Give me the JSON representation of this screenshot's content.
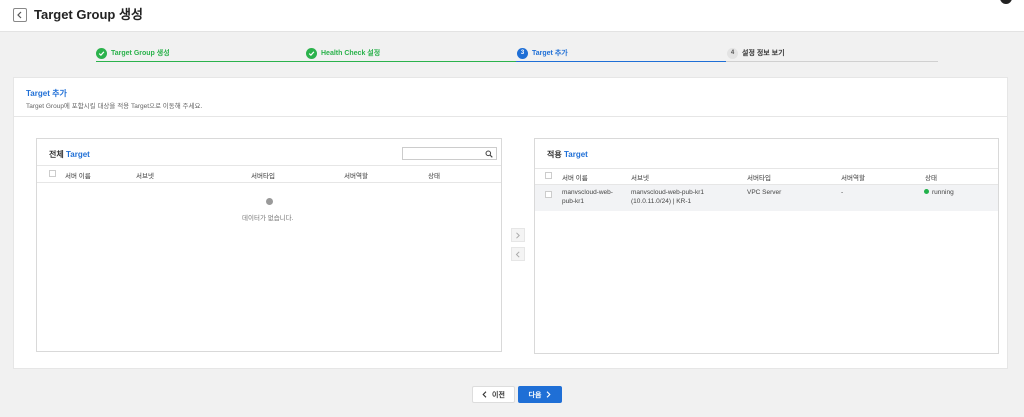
{
  "header": {
    "title": "Target Group 생성"
  },
  "steps": [
    {
      "number": "1",
      "label": "Target Group 생성",
      "state": "done"
    },
    {
      "number": "2",
      "label": "Health Check 설정",
      "state": "done"
    },
    {
      "number": "3",
      "label": "Target 추가",
      "state": "active"
    },
    {
      "number": "4",
      "label": "설정 정보 보기",
      "state": "pending"
    }
  ],
  "colors": {
    "done": "#2bb24c",
    "active": "#1f6fd6",
    "pending": "#9a9a9a"
  },
  "section": {
    "title": "Target 추가",
    "description": "Target Group에 포함시킬 대상을 적용 Target으로 이동해 주세요."
  },
  "left_panel": {
    "title_prefix": "전체",
    "title_highlight": "Target",
    "search_placeholder": "",
    "columns": [
      "서버 이름",
      "서브넷",
      "서버타입",
      "서버역할",
      "상태"
    ],
    "empty_text": "데이터가 없습니다."
  },
  "right_panel": {
    "title_prefix": "적용",
    "title_highlight": "Target",
    "columns": [
      "서버 이름",
      "서브넷",
      "서버타입",
      "서버역할",
      "상태"
    ],
    "rows": [
      {
        "name_line1": "manvscloud-web-",
        "name_line2": "pub-kr1",
        "subnet_line1": "manvscloud-web-pub-kr1",
        "subnet_line2": "(10.0.11.0/24) | KR-1",
        "type": "VPC Server",
        "role": "-",
        "status": "running"
      }
    ]
  },
  "footer": {
    "prev_label": "이전",
    "next_label": "다음"
  }
}
